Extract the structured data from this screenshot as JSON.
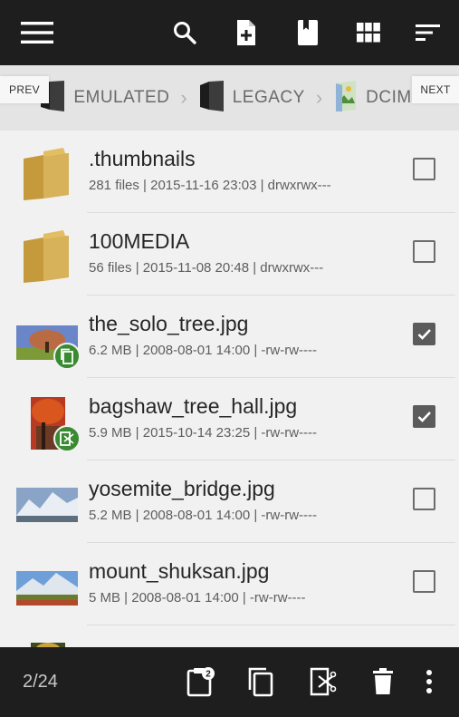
{
  "toolbar": {
    "menu_icon": "hamburger-menu-icon",
    "search_icon": "search-icon",
    "new_file_icon": "new-file-icon",
    "bookmark_icon": "bookmark-icon",
    "grid_icon": "grid-view-icon",
    "sort_icon": "sort-icon"
  },
  "breadcrumb": {
    "prev_label": "PREV",
    "next_label": "NEXT",
    "items": [
      {
        "label": "EMULATED",
        "icon": "drive-icon"
      },
      {
        "label": "LEGACY",
        "icon": "drive-icon"
      },
      {
        "label": "DCIM",
        "icon": "image-folder-icon"
      }
    ]
  },
  "files": [
    {
      "name": ".thumbnails",
      "details": "281 files | 2015-11-16 23:03 | drwxrwx---",
      "type": "folder",
      "checked": false
    },
    {
      "name": "100MEDIA",
      "details": "56 files | 2015-11-08 20:48 | drwxrwx---",
      "type": "folder",
      "checked": false
    },
    {
      "name": "the_solo_tree.jpg",
      "details": "6.2 MB | 2008-08-01 14:00 | -rw-rw----",
      "type": "image",
      "checked": true,
      "badge": "copy-icon"
    },
    {
      "name": "bagshaw_tree_hall.jpg",
      "details": "5.9 MB | 2015-10-14 23:25 | -rw-rw----",
      "type": "image",
      "checked": true,
      "badge": "cut-icon"
    },
    {
      "name": "yosemite_bridge.jpg",
      "details": "5.2 MB | 2008-08-01 14:00 | -rw-rw----",
      "type": "image",
      "checked": false
    },
    {
      "name": "mount_shuksan.jpg",
      "details": "5 MB | 2008-08-01 14:00 | -rw-rw----",
      "type": "image",
      "checked": false
    }
  ],
  "bottom": {
    "count": "2/24",
    "paste_badge": "2",
    "icons": [
      "paste-icon",
      "copy-icon",
      "cut-icon",
      "delete-icon",
      "more-options-icon"
    ]
  },
  "colors": {
    "bar": "#1e1e1e",
    "list_bg": "#f1f1f1",
    "badge_green": "#3a8a32",
    "folder": "#d8b25a"
  }
}
